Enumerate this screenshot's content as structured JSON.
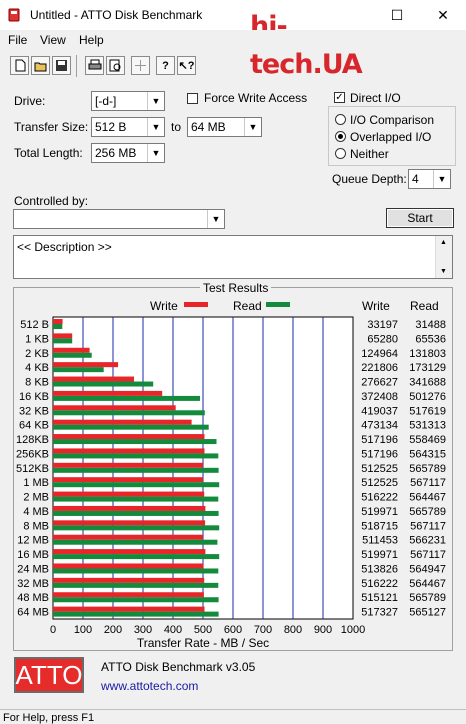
{
  "window": {
    "title": "Untitled - ATTO Disk Benchmark",
    "minimize": "—",
    "maximize": "☐",
    "close": "✕"
  },
  "watermark": {
    "text": "hi-tech.UA"
  },
  "menu": {
    "file": "File",
    "view": "View",
    "help": "Help"
  },
  "toolbar": {
    "icons": [
      "new-icon",
      "open-icon",
      "save-icon",
      "print-icon",
      "print-preview-icon",
      "move-icon",
      "help-icon",
      "context-help-icon"
    ]
  },
  "form": {
    "drive_label": "Drive:",
    "drive_value": "[-d-]",
    "force_write_label": "Force Write Access",
    "force_write_checked": false,
    "direct_io_label": "Direct I/O",
    "direct_io_checked": true,
    "transfer_size_label": "Transfer Size:",
    "transfer_from": "512 B",
    "to_label": "to",
    "transfer_to": "64 MB",
    "total_length_label": "Total Length:",
    "total_length": "256 MB",
    "io_comparison": "I/O Comparison",
    "overlapped_io": "Overlapped I/O",
    "neither": "Neither",
    "selected_mode": "Overlapped I/O",
    "queue_depth_label": "Queue Depth:",
    "queue_depth": "4",
    "controlled_by_label": "Controlled by:",
    "controlled_by_value": "",
    "start_label": "Start",
    "description": "<< Description >>"
  },
  "results": {
    "title": "Test Results",
    "legend_write": "Write",
    "legend_read": "Read",
    "col_write": "Write",
    "col_read": "Read",
    "write_color": "#e8262a",
    "read_color": "#138a3c"
  },
  "chart_data": {
    "type": "bar",
    "orientation": "horizontal",
    "xlabel": "Transfer Rate - MB / Sec",
    "xlim": [
      0,
      1000
    ],
    "xticks": [
      "0",
      "100",
      "200",
      "300",
      "400",
      "500",
      "600",
      "700",
      "800",
      "900",
      "1000"
    ],
    "grid": true,
    "categories": [
      "512 B",
      "1 KB",
      "2 KB",
      "4 KB",
      "8 KB",
      "16 KB",
      "32 KB",
      "64 KB",
      "128KB",
      "256KB",
      "512KB",
      "1 MB",
      "2 MB",
      "4 MB",
      "8 MB",
      "12 MB",
      "16 MB",
      "24 MB",
      "32 MB",
      "48 MB",
      "64 MB"
    ],
    "series": [
      {
        "name": "Write",
        "values": [
          32,
          64,
          122,
          217,
          270,
          364,
          409,
          462,
          505,
          505,
          500,
          500,
          504,
          508,
          507,
          500,
          508,
          502,
          504,
          503,
          505
        ]
      },
      {
        "name": "Read",
        "values": [
          31,
          64,
          129,
          169,
          334,
          490,
          506,
          519,
          545,
          551,
          552,
          554,
          551,
          552,
          554,
          548,
          554,
          551,
          551,
          552,
          552
        ]
      }
    ],
    "write_kbps": [
      "33197",
      "65280",
      "124964",
      "221806",
      "276627",
      "372408",
      "419037",
      "473134",
      "517196",
      "517196",
      "512525",
      "512525",
      "516222",
      "519971",
      "518715",
      "511453",
      "519971",
      "513826",
      "516222",
      "515121",
      "517327"
    ],
    "read_kbps": [
      "31488",
      "65536",
      "131803",
      "173129",
      "341688",
      "501276",
      "517619",
      "531313",
      "558469",
      "564315",
      "565789",
      "567117",
      "564467",
      "565789",
      "567117",
      "566231",
      "567117",
      "564947",
      "564467",
      "565789",
      "565127"
    ]
  },
  "footer": {
    "logo": "ATTO",
    "product": "ATTO Disk Benchmark v3.05",
    "url": "www.attotech.com"
  },
  "status": {
    "text": "For Help, press F1"
  }
}
